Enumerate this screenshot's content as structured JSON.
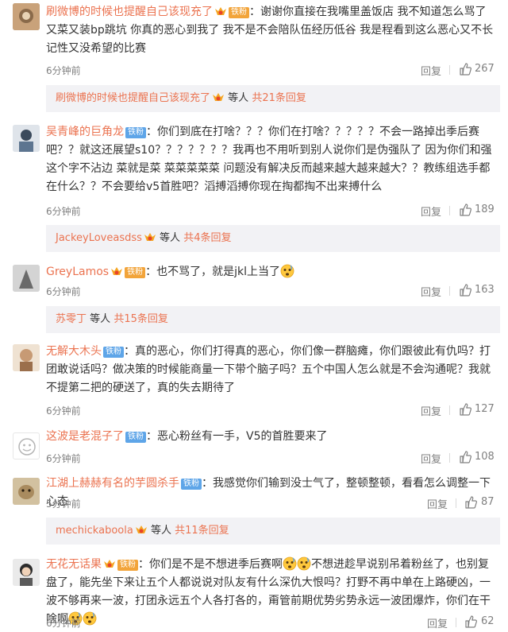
{
  "comments": [
    {
      "username": "刷微博的时候也提醒自己该现充了",
      "badge": "铁粉",
      "text": "谢谢你直接在我嘴里盖饭店 我不知道怎么骂了 又菜又装bp跳坑 你真的恶心到我了 我不是不会陪队伍经历低谷 我是程看到这么恶心又不长记性又没希望的比赛",
      "time": "6分钟前",
      "reply_label": "回复",
      "likes": "267",
      "sub": {
        "name": "刷微博的时候也提醒自己该现充了",
        "others": "等人",
        "more": "共21条回复"
      }
    },
    {
      "username": "吴青峰的巨角龙",
      "badge": "铁粉",
      "text": "你们到底在打啥？？？你们在打啥？？？？？不会一路掉出季后赛吧？？就这还展望s10？？？？？？？我再也不用听到别人说你们是伪强队了 因为你们和强这个字不沾边 菜就是菜 菜菜菜菜菜 问题没有解决反而越来越大越来越大？？教练组选手都在什么？？不会要给v5首胜吧？滔搏滔搏你现在掏都掏不出来搏什么",
      "time": "6分钟前",
      "reply_label": "回复",
      "likes": "189",
      "sub": {
        "name": "JackeyLoveasdss",
        "others": "等人",
        "more": "共4条回复"
      }
    },
    {
      "username": "GreyLamos",
      "badge": "铁粉",
      "text": "也不骂了，就是jkl上当了",
      "time": "6分钟前",
      "reply_label": "回复",
      "likes": "163",
      "sub": {
        "name": "苏零丁",
        "others": "等人",
        "more": "共15条回复"
      }
    },
    {
      "username": "无解大木头",
      "badge": "铁粉",
      "text": "真的恶心，你们打得真的恶心，你们像一群脑瘫，你们跟彼此有仇吗？打团敢说话吗？做决策的时候能商量一下带个脑子吗？五个中国人怎么就是不会沟通呢？我就不提第二把的硬送了，真的失去期待了",
      "time": "6分钟前",
      "reply_label": "回复",
      "likes": "127"
    },
    {
      "username": "这波是老混子了",
      "badge": "铁粉",
      "text": "恶心粉丝有一手，V5的首胜要来了",
      "time": "6分钟前",
      "reply_label": "回复",
      "likes": "108"
    },
    {
      "username": "江湖上赫赫有名的芋圆杀手",
      "badge": "铁粉",
      "text": "我感觉你们输到没士气了，整顿整顿，看看怎么调整一下心态",
      "time": "5分钟前",
      "reply_label": "回复",
      "likes": "87",
      "sub": {
        "name": "mechickaboola",
        "others": "等人",
        "more": "共11条回复"
      }
    },
    {
      "username": "无花无话果",
      "badge": "铁粉",
      "text_a": "你们是不是不想进季后赛啊",
      "text_b": "不想进趁早说别吊着粉丝了，也别复盘了，能先坐下来让五个人都说说对队友有什么深仇大恨吗？打野不再中单在上路硬凶，一波不够再来一波，打团永远五个人各打各的，甭管前期优势劣势永远一波团爆炸，你们在干啥啊",
      "time": "6分钟前",
      "reply_label": "回复",
      "likes": "62"
    }
  ],
  "colors": {
    "accent": "#eb7350",
    "fan_badge": "#5ea5e8",
    "subreply_bg": "#f2f2f5"
  }
}
